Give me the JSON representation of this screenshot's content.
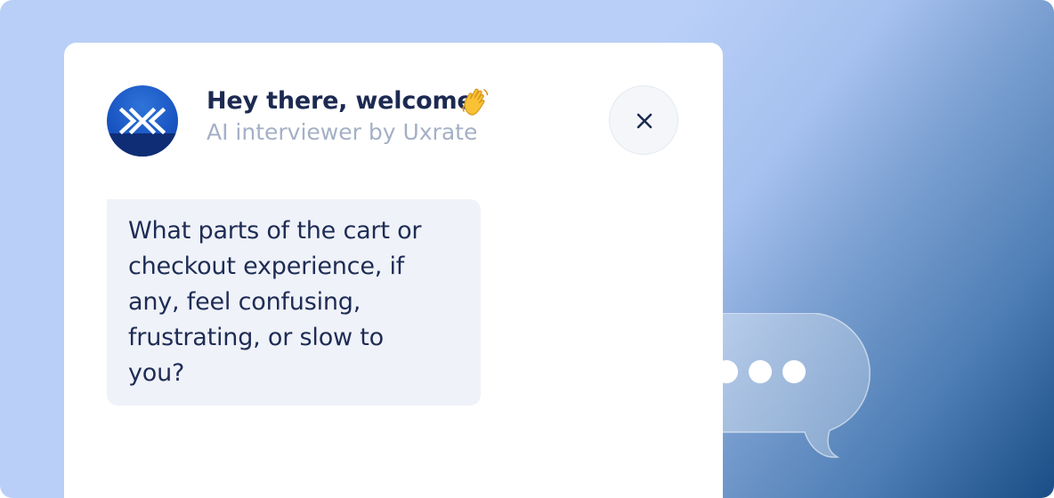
{
  "header": {
    "title": "Hey there, welcome",
    "title_emoji_icon": "waving-hand-icon",
    "subtitle": "AI interviewer by Uxrate",
    "avatar_icon": "uxrate-logo"
  },
  "close_button": {
    "icon": "close-icon"
  },
  "message": {
    "line1": "What parts of the cart or",
    "line2": "checkout experience, if",
    "line3": "any, feel confusing,",
    "line4": "frustrating, or slow to",
    "line5": "you?"
  },
  "typing_indicator": {
    "icon": "typing-dots-icon"
  },
  "colors": {
    "accent": "#1a56c4",
    "text_dark": "#1c2a52",
    "text_muted": "#a4b0c6",
    "bubble_bg": "#eff2f8"
  }
}
